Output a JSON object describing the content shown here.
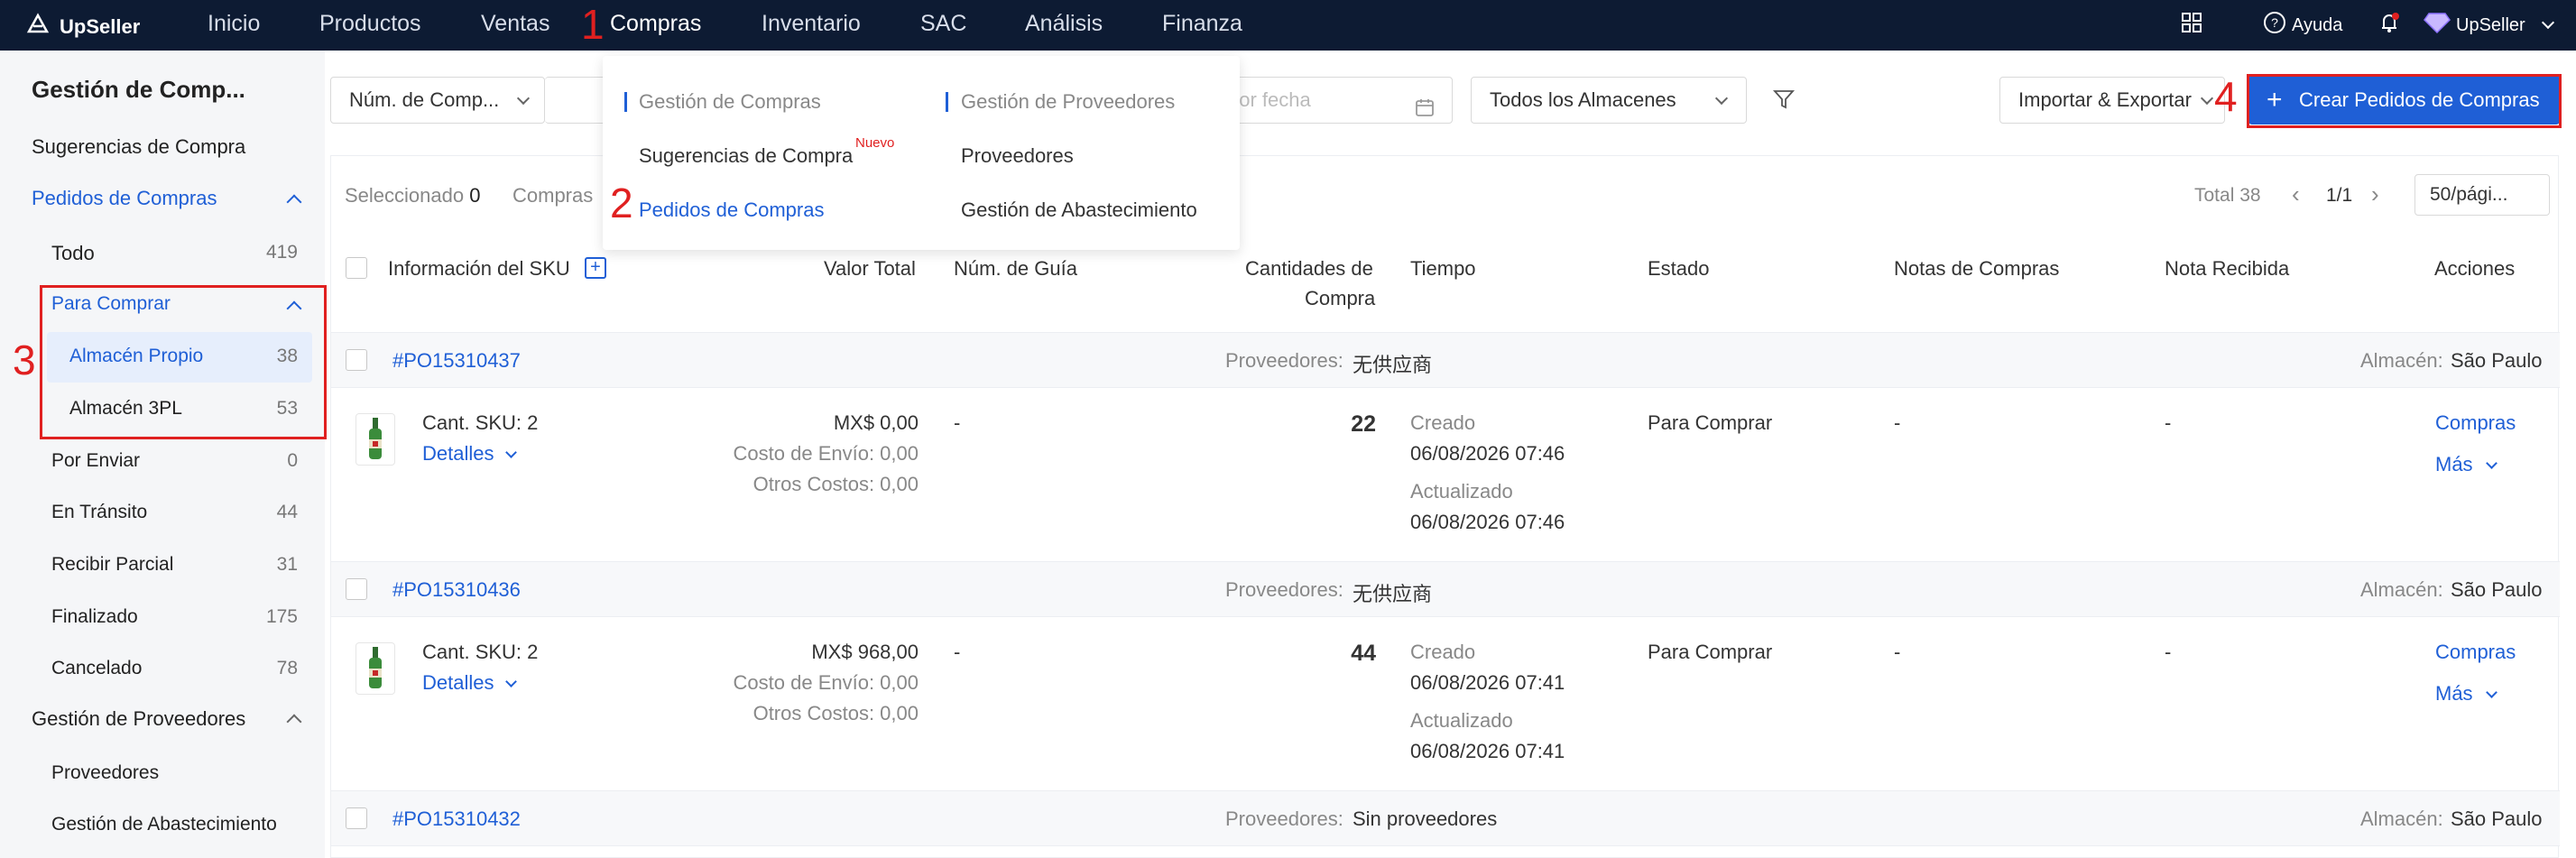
{
  "topbar": {
    "brand": "UpSeller",
    "nav": [
      "Inicio",
      "Productos",
      "Ventas",
      "Compras",
      "Inventario",
      "SAC",
      "Análisis",
      "Finanza"
    ],
    "help": "Ayuda",
    "account": "UpSeller"
  },
  "sidebar": {
    "title": "Gestión de Comp...",
    "sugerencias": "Sugerencias de Compra",
    "pedidos": "Pedidos de Compras",
    "todo": {
      "label": "Todo",
      "count": "419"
    },
    "para_comprar": "Para Comprar",
    "almacen_propio": {
      "label": "Almacén Propio",
      "count": "38"
    },
    "almacen_3pl": {
      "label": "Almacén 3PL",
      "count": "53"
    },
    "por_enviar": {
      "label": "Por Enviar",
      "count": "0"
    },
    "en_transito": {
      "label": "En Tránsito",
      "count": "44"
    },
    "recibir_parcial": {
      "label": "Recibir Parcial",
      "count": "31"
    },
    "finalizado": {
      "label": "Finalizado",
      "count": "175"
    },
    "cancelado": {
      "label": "Cancelado",
      "count": "78"
    },
    "gestion_proveedores": "Gestión de Proveedores",
    "proveedores": "Proveedores",
    "gestion_abastecimiento": "Gestión de Abastecimiento"
  },
  "filters": {
    "search_type": "Núm. de Comp...",
    "date_placeholder": "por fecha",
    "warehouse": "Todos los Almacenes",
    "import_export": "Importar & Exportar",
    "create_button": "Crear Pedidos de Compras"
  },
  "list_bar": {
    "selected_label": "Seleccionado",
    "selected_count": "0",
    "compras_label": "Compras",
    "total": "Total 38",
    "page": "1/1",
    "per_page": "50/pági..."
  },
  "columns": {
    "sku_info": "Información del SKU",
    "valor_total": "Valor Total",
    "num_guia": "Núm. de Guía",
    "cantidades_1": "Cantidades de",
    "cantidades_2": "Compra",
    "tiempo": "Tiempo",
    "estado": "Estado",
    "notas": "Notas de Compras",
    "nota_recibida": "Nota Recibida",
    "acciones": "Acciones"
  },
  "orders": [
    {
      "id": "#PO15310437",
      "proveedores_label": "Proveedores:",
      "proveedor": "无供应商",
      "almacen_label": "Almacén:",
      "almacen": "São Paulo",
      "sku_count": "Cant. SKU: 2",
      "detalles": "Detalles",
      "valor": "MX$ 0,00",
      "envio": "Costo de Envío: 0,00",
      "otros": "Otros Costos: 0,00",
      "guia": "-",
      "cantidad": "22",
      "creado_label": "Creado",
      "creado": "06/08/2026 07:46",
      "actualizado_label": "Actualizado",
      "actualizado": "06/08/2026 07:46",
      "estado": "Para Comprar",
      "notas": "-",
      "nota_recibida": "-",
      "accion_1": "Compras",
      "accion_2": "Más"
    },
    {
      "id": "#PO15310436",
      "proveedores_label": "Proveedores:",
      "proveedor": "无供应商",
      "almacen_label": "Almacén:",
      "almacen": "São Paulo",
      "sku_count": "Cant. SKU: 2",
      "detalles": "Detalles",
      "valor": "MX$ 968,00",
      "envio": "Costo de Envío: 0,00",
      "otros": "Otros Costos: 0,00",
      "guia": "-",
      "cantidad": "44",
      "creado_label": "Creado",
      "creado": "06/08/2026 07:41",
      "actualizado_label": "Actualizado",
      "actualizado": "06/08/2026 07:41",
      "estado": "Para Comprar",
      "notas": "-",
      "nota_recibida": "-",
      "accion_1": "Compras",
      "accion_2": "Más"
    },
    {
      "id": "#PO15310432",
      "proveedores_label": "Proveedores:",
      "proveedor": "Sin proveedores",
      "almacen_label": "Almacén:",
      "almacen": "São Paulo"
    }
  ],
  "dropdown": {
    "group1_title": "Gestión de Compras",
    "group1_item1": "Sugerencias de Compra",
    "group1_badge": "Nuevo",
    "group1_item2": "Pedidos de Compras",
    "group2_title": "Gestión de Proveedores",
    "group2_item1": "Proveedores",
    "group2_item2": "Gestión de Abastecimiento"
  },
  "annotations": [
    "1",
    "2",
    "3",
    "4"
  ],
  "colors": {
    "topbar": "#0d1b33",
    "accent": "#1f5fd6",
    "annotation": "#e02020",
    "badge": "#e02020"
  }
}
